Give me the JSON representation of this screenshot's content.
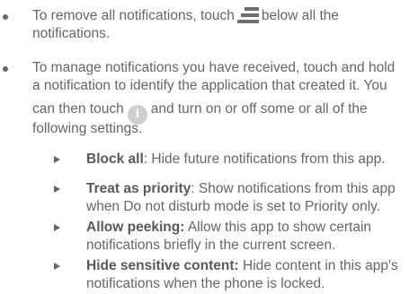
{
  "bullets": [
    {
      "line1_before": "To remove all notifications, touch",
      "icon1": "clear-all-icon",
      "line1_after": "below all the",
      "line2": "notifications."
    },
    {
      "line1": "To manage notifications you have received, touch and hold",
      "line2": "a notification to identify the application that created it. You",
      "line3_before": "can then touch",
      "icon2": "info-icon",
      "icon2_glyph": "i",
      "line3_after": "and turn on or off some or all of the",
      "line4": "following settings."
    }
  ],
  "settings": [
    {
      "term": "Block all",
      "sep": ":",
      "line1": " Hide future notifications from this app."
    },
    {
      "term": "Treat as priority",
      "sep": ":",
      "line1": " Show notifications from this app",
      "line2": "when Do not disturb mode is set to Priority only."
    },
    {
      "term": "Allow peeking:",
      "line1": " Allow this app to show certain",
      "line2": "notifications briefly in the current screen."
    },
    {
      "term": "Hide sensitive content:",
      "line1": " Hide content in this app's",
      "line2": "notifications when the phone is locked."
    }
  ]
}
